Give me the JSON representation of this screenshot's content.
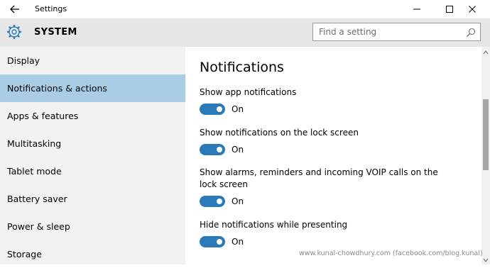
{
  "window": {
    "title": "Settings",
    "minimize_icon": "minimize-icon",
    "maximize_icon": "maximize-icon",
    "close_icon": "close-icon"
  },
  "header": {
    "section": "SYSTEM",
    "search_placeholder": "Find a setting"
  },
  "sidebar": {
    "items": [
      {
        "label": "Display"
      },
      {
        "label": "Notifications & actions"
      },
      {
        "label": "Apps & features"
      },
      {
        "label": "Multitasking"
      },
      {
        "label": "Tablet mode"
      },
      {
        "label": "Battery saver"
      },
      {
        "label": "Power & sleep"
      },
      {
        "label": "Storage"
      }
    ],
    "selected": "Notifications & actions"
  },
  "main": {
    "heading": "Notifications",
    "settings": [
      {
        "label": "Show app notifications",
        "state": "On"
      },
      {
        "label": "Show notifications on the lock screen",
        "state": "On"
      },
      {
        "label": "Show alarms, reminders and incoming VOIP calls on the lock screen",
        "state": "On"
      },
      {
        "label": "Hide notifications while presenting",
        "state": "On"
      }
    ]
  },
  "watermark": "www.kunal-chowdhury.com (facebook.com/blog.kunal)",
  "colors": {
    "accent": "#2a7ab9",
    "selected_nav": "#aacde6",
    "header_bg": "#e6e6e6",
    "sidebar_bg": "#f2f2f2"
  }
}
